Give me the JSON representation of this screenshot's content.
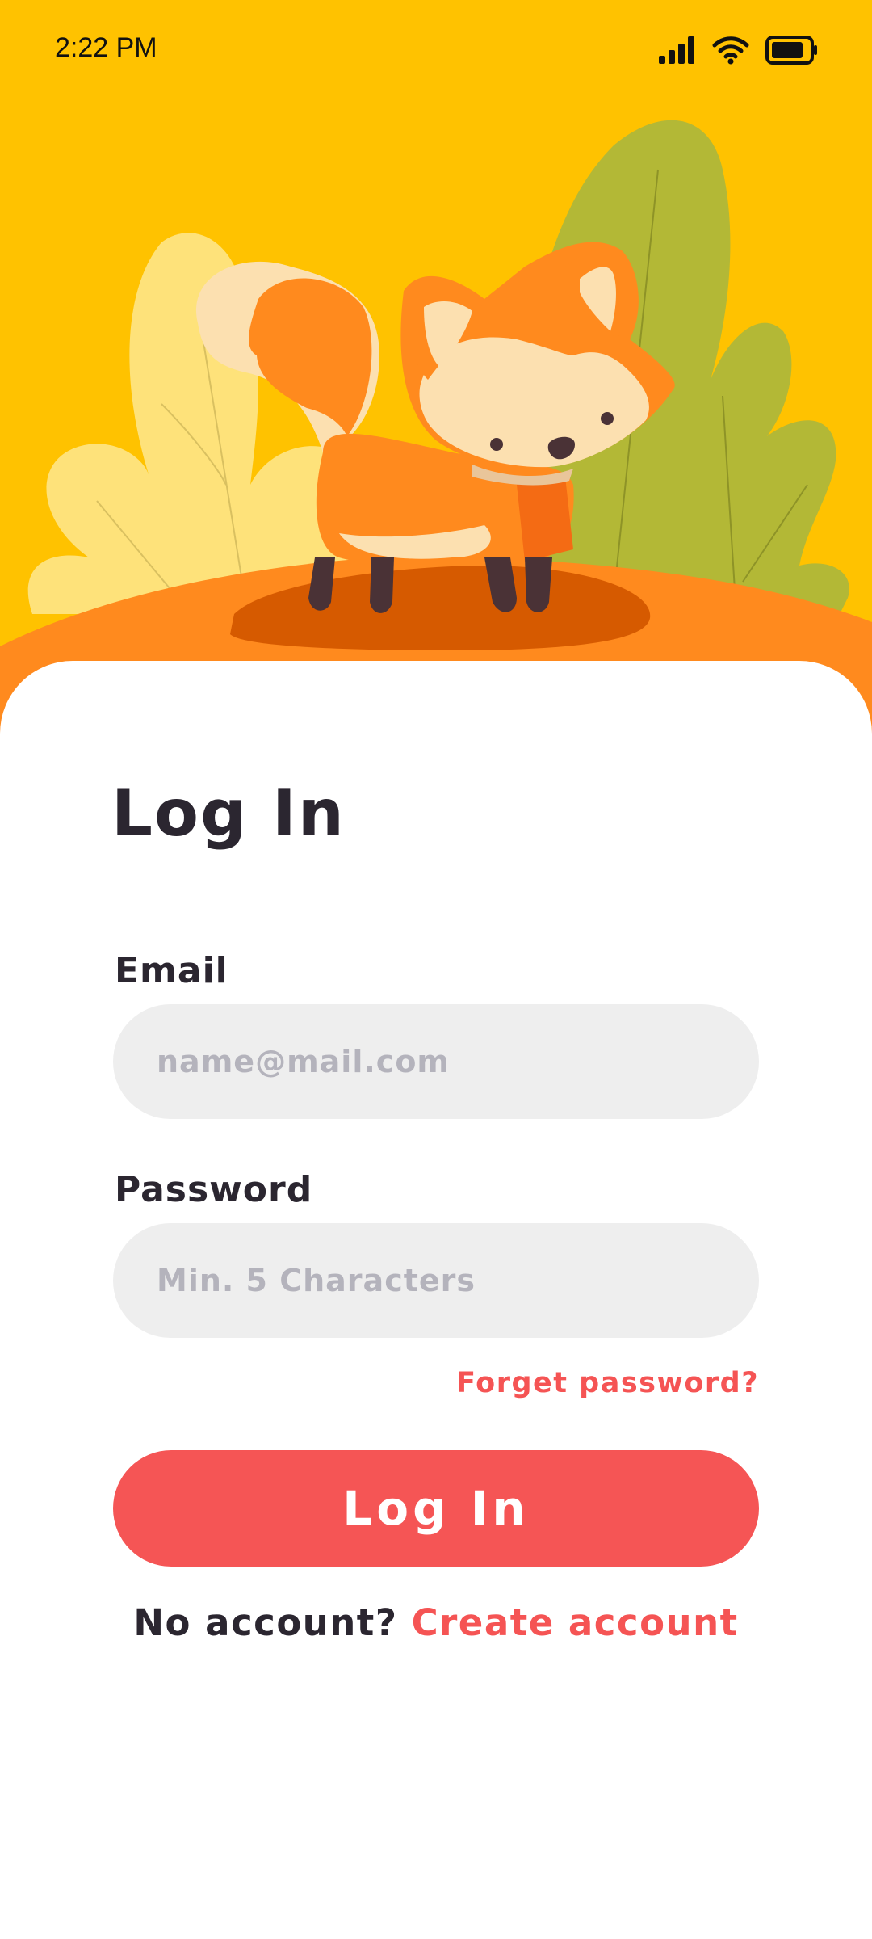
{
  "status_bar": {
    "time": "2:22 PM",
    "icons": [
      "signal-icon",
      "wifi-icon",
      "battery-icon"
    ]
  },
  "colors": {
    "background_hero": "#FFC200",
    "accent": "#F55555",
    "input_background": "#EEEEEE",
    "text_dark": "#2B2630",
    "placeholder": "#B4B3BC"
  },
  "illustration": {
    "subject": "fox-illustration"
  },
  "login": {
    "title": "Log In",
    "email_label": "Email",
    "email_placeholder": "name@mail.com",
    "email_value": "",
    "password_label": "Password",
    "password_placeholder": "Min. 5 Characters",
    "password_value": "",
    "forgot_password": "Forget password?",
    "login_button": "Log In",
    "no_account_text": "No account?",
    "create_account_link": "Create account"
  }
}
